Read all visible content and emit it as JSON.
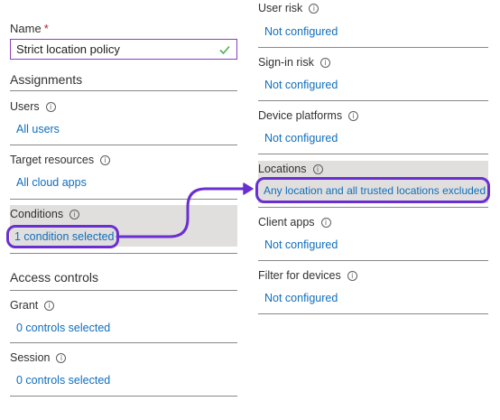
{
  "name_field": {
    "label": "Name",
    "required_mark": "*",
    "value": "Strict location policy"
  },
  "assignments": {
    "title": "Assignments",
    "items": [
      {
        "label": "Users",
        "link": "All users"
      },
      {
        "label": "Target resources",
        "link": "All cloud apps"
      },
      {
        "label": "Conditions",
        "link": "1 condition selected"
      }
    ]
  },
  "access_controls": {
    "title": "Access controls",
    "items": [
      {
        "label": "Grant",
        "link": "0 controls selected"
      },
      {
        "label": "Session",
        "link": "0 controls selected"
      }
    ]
  },
  "conditions_panel": {
    "items": [
      {
        "label": "User risk",
        "link": "Not configured"
      },
      {
        "label": "Sign-in risk",
        "link": "Not configured"
      },
      {
        "label": "Device platforms",
        "link": "Not configured"
      },
      {
        "label": "Locations",
        "link": "Any location and all trusted locations excluded"
      },
      {
        "label": "Client apps",
        "link": "Not configured"
      },
      {
        "label": "Filter for devices",
        "link": "Not configured"
      }
    ]
  },
  "info_glyph": "i",
  "colors": {
    "link": "#106ebe",
    "highlight": "#6a2fd0",
    "selected_bg": "#e1dfdd",
    "valid_check": "#4caf50"
  }
}
